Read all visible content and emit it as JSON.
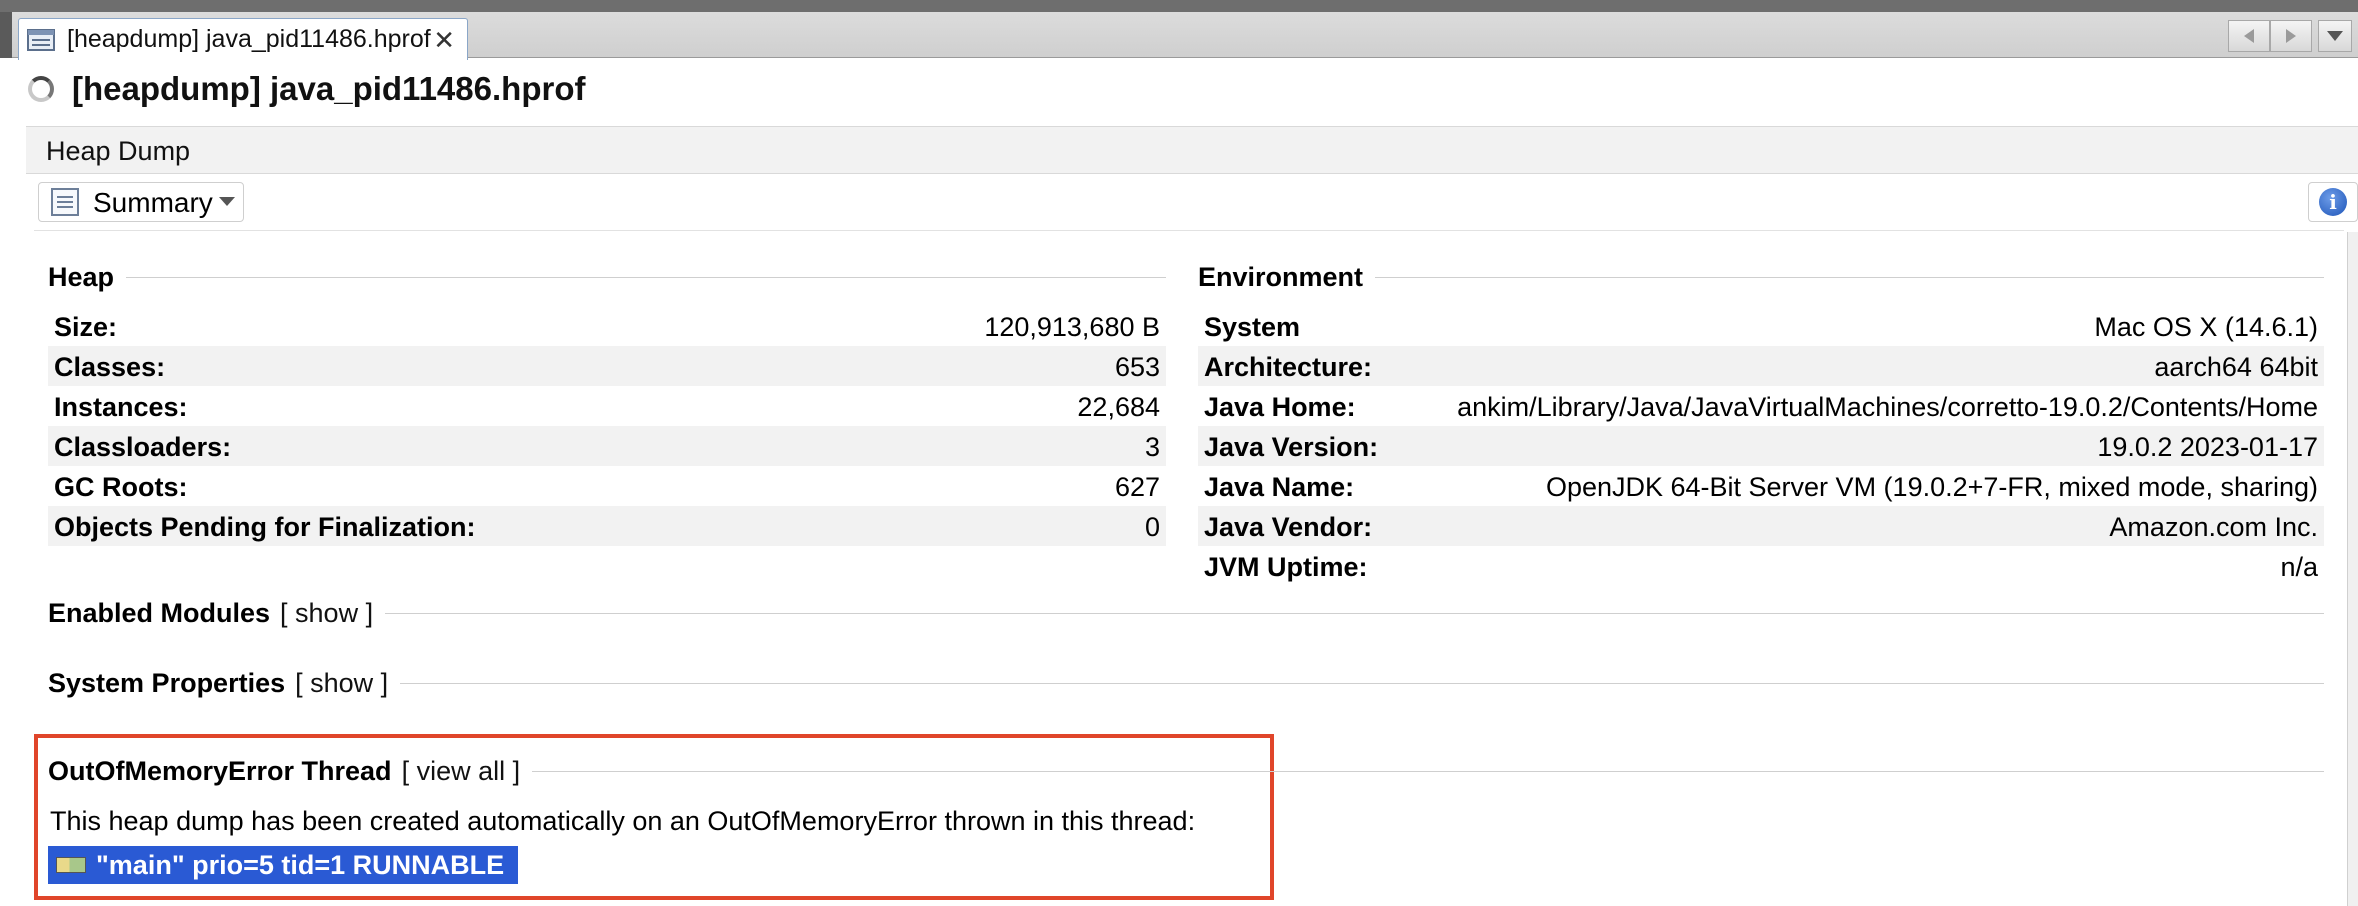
{
  "tab": {
    "label": "[heapdump] java_pid11486.hprof",
    "close": "✕"
  },
  "title": "[heapdump] java_pid11486.hprof",
  "subheader": "Heap Dump",
  "view_selector": {
    "value": "Summary"
  },
  "heap": {
    "title": "Heap",
    "rows": [
      {
        "label": "Size:",
        "value": "120,913,680 B"
      },
      {
        "label": "Classes:",
        "value": "653"
      },
      {
        "label": "Instances:",
        "value": "22,684"
      },
      {
        "label": "Classloaders:",
        "value": "3"
      },
      {
        "label": "GC Roots:",
        "value": "627"
      },
      {
        "label": "Objects Pending for Finalization:",
        "value": "0"
      }
    ]
  },
  "environment": {
    "title": "Environment",
    "rows": [
      {
        "label": "System",
        "value": "Mac OS X (14.6.1)"
      },
      {
        "label": "Architecture:",
        "value": "aarch64 64bit"
      },
      {
        "label": "Java Home:",
        "value": "ankim/Library/Java/JavaVirtualMachines/corretto-19.0.2/Contents/Home"
      },
      {
        "label": "Java Version:",
        "value": "19.0.2 2023-01-17"
      },
      {
        "label": "Java Name:",
        "value": "OpenJDK 64-Bit Server VM (19.0.2+7-FR, mixed mode, sharing)"
      },
      {
        "label": "Java Vendor:",
        "value": "Amazon.com Inc."
      },
      {
        "label": "JVM Uptime:",
        "value": "n/a"
      }
    ]
  },
  "enabled_modules": {
    "title": "Enabled Modules",
    "link": "[ show ]"
  },
  "system_properties": {
    "title": "System Properties",
    "link": "[ show ]"
  },
  "oom_thread": {
    "title": "OutOfMemoryError Thread",
    "link": "[ view all ]",
    "description": "This heap dump has been created automatically on an OutOfMemoryError thrown in this thread:",
    "thread": "\"main\" prio=5 tid=1 RUNNABLE"
  },
  "colors": {
    "highlight_border": "#e0452a",
    "selection_bg": "#2a5ad4"
  }
}
